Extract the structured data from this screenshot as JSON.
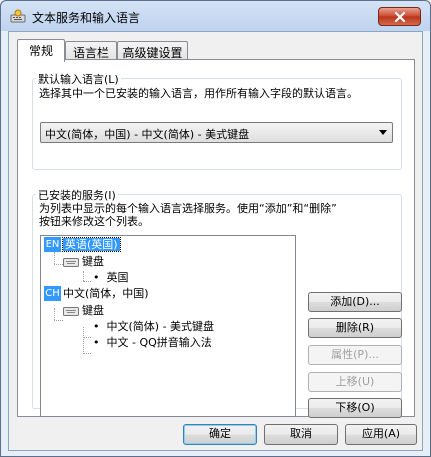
{
  "window": {
    "title": "文本服务和输入语言",
    "icon": "keyboard-settings-icon"
  },
  "tabs": [
    {
      "label": "常规",
      "active": true
    },
    {
      "label": "语言栏",
      "active": false
    },
    {
      "label": "高级键设置",
      "active": false
    }
  ],
  "default_language": {
    "group_title": "默认输入语言(L)",
    "description": "选择其中一个已安装的输入语言，用作所有输入字段的默认语言。",
    "selected": "中文(简体，中国) - 中文(简体) - 美式键盘"
  },
  "installed_services": {
    "group_title": "已安装的服务(I)",
    "description_line1": "为列表中显示的每个输入语言选择服务。使用“添加”和“删除”",
    "description_line2": "按钮来修改这个列表。",
    "tree": {
      "en_badge": "EN",
      "en_label": "英语(英国)",
      "en_keyboard": "键盘",
      "en_layout": "英国",
      "ch_badge": "CH",
      "ch_label": "中文(简体，中国)",
      "ch_keyboard": "键盘",
      "ch_layout1": "中文(简体) - 美式键盘",
      "ch_layout2": "中文 - QQ拼音输入法"
    },
    "buttons": {
      "add": "添加(D)...",
      "remove": "删除(R)",
      "properties": "属性(P)...",
      "move_up": "上移(U)",
      "move_down": "下移(O)"
    }
  },
  "footer": {
    "ok": "确定",
    "cancel": "取消",
    "apply": "应用(A)"
  },
  "colors": {
    "selection": "#3399ff",
    "close_button": "#c9462c"
  }
}
